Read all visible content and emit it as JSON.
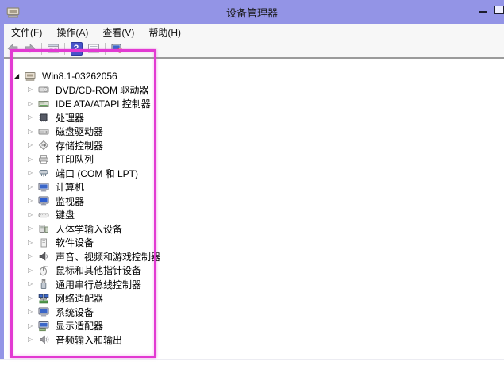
{
  "window": {
    "title": "设备管理器"
  },
  "menubar": {
    "items": [
      "文件(F)",
      "操作(A)",
      "查看(V)",
      "帮助(H)"
    ]
  },
  "toolbar": {
    "help_glyph": "?"
  },
  "tree": {
    "glyphs": {
      "expanded": "◢",
      "collapsed": "▷"
    },
    "root": {
      "label": "Win8.1-03262056",
      "icon": "computer-root"
    },
    "items": [
      {
        "label": "DVD/CD-ROM 驱动器",
        "icon": "disc-drive"
      },
      {
        "label": "IDE ATA/ATAPI 控制器",
        "icon": "ide-controller"
      },
      {
        "label": "处理器",
        "icon": "processor"
      },
      {
        "label": "磁盘驱动器",
        "icon": "disk-drive"
      },
      {
        "label": "存储控制器",
        "icon": "storage-controller"
      },
      {
        "label": "打印队列",
        "icon": "print-queue"
      },
      {
        "label": "端口 (COM 和 LPT)",
        "icon": "ports"
      },
      {
        "label": "计算机",
        "icon": "computer"
      },
      {
        "label": "监视器",
        "icon": "monitor"
      },
      {
        "label": "键盘",
        "icon": "keyboard"
      },
      {
        "label": "人体学输入设备",
        "icon": "hid"
      },
      {
        "label": "软件设备",
        "icon": "software-device"
      },
      {
        "label": "声音、视频和游戏控制器",
        "icon": "sound-controller"
      },
      {
        "label": "鼠标和其他指针设备",
        "icon": "mouse"
      },
      {
        "label": "通用串行总线控制器",
        "icon": "usb-controller"
      },
      {
        "label": "网络适配器",
        "icon": "network-adapter"
      },
      {
        "label": "系统设备",
        "icon": "system-devices"
      },
      {
        "label": "显示适配器",
        "icon": "display-adapter"
      },
      {
        "label": "音频输入和输出",
        "icon": "audio-io"
      }
    ]
  },
  "colors": {
    "titlebar": "#9394E6",
    "annotation": "#E23AD2",
    "help_button": "#4653C8",
    "toolbar_rule": "#9B9B9B",
    "screen_blue": "#3A66C8"
  }
}
